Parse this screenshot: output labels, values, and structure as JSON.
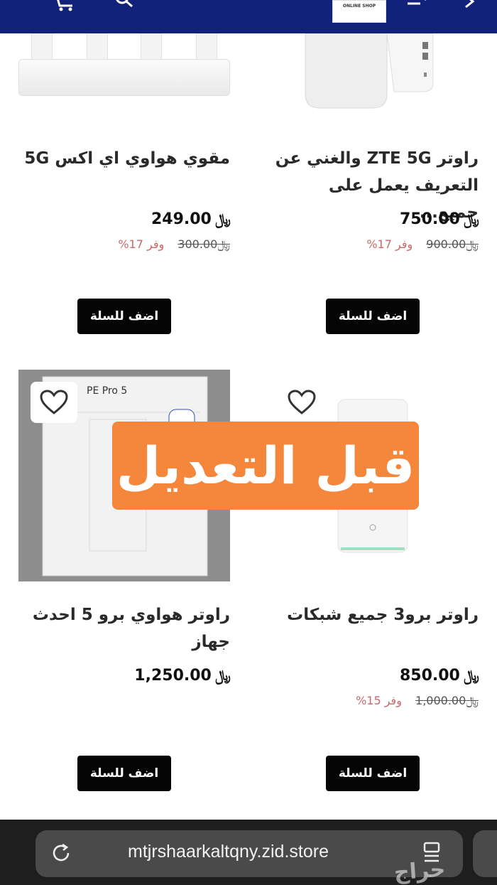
{
  "header": {
    "logo_text": "ONLINE SHOP",
    "icons": [
      "cart-icon",
      "search-icon",
      "menu-icon",
      "back-arrow-icon"
    ]
  },
  "currency_symbol": "﷼",
  "products": [
    {
      "title": "راوتر ZTE 5G والغني عن التعريف يعمل على جميع...",
      "price": "750.00",
      "old_price": "900.00",
      "save": "وفر 17%",
      "button": "اضف للسلة"
    },
    {
      "title": "مقوي هواوي اي اكس 5G",
      "price": "249.00",
      "old_price": "300.00",
      "save": "وفر 17%",
      "button": "اضف للسلة"
    },
    {
      "title": "راوتر برو3 جميع شبكات",
      "price": "850.00",
      "old_price": "1,000.00",
      "save": "وفر 15%",
      "button": "اضف للسلة"
    },
    {
      "title": "راوتر هواوي برو 5 احدث جهاز",
      "price": "1,250.00",
      "button": "اضف للسلة",
      "image_text": "PE Pro 5"
    }
  ],
  "overlay_text": "قبل التعديل",
  "browser": {
    "url": "mtjrshaarkaltqny.zid.store"
  },
  "watermark": "حراج",
  "colors": {
    "header": "#12217a",
    "button": "#050505",
    "save_text": "#c96a6a",
    "overlay": "#f4873c"
  }
}
